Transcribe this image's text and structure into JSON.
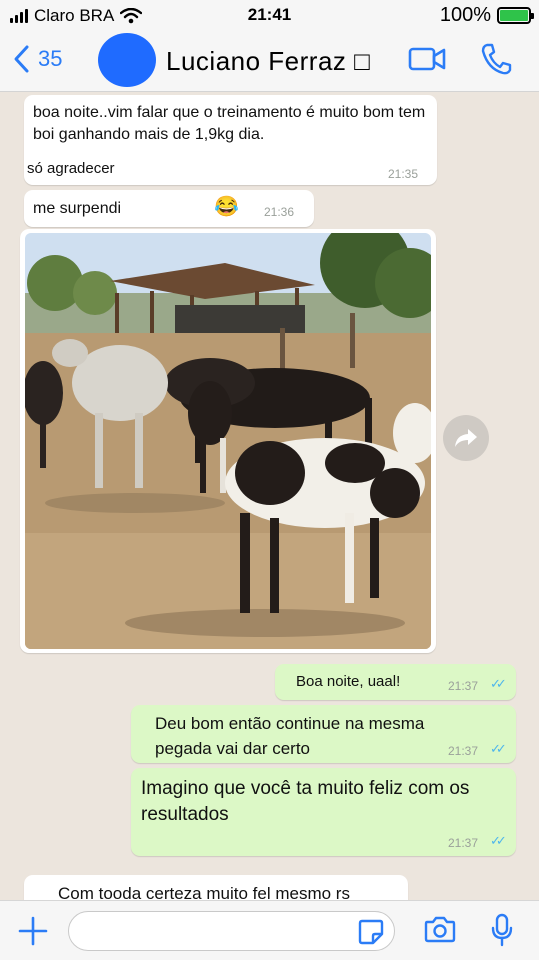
{
  "status_bar": {
    "carrier": "Claro BRA",
    "time": "21:41",
    "battery": "100%"
  },
  "header": {
    "back_count": "35",
    "contact_name": "Luciano Ferraz □"
  },
  "messages": [
    {
      "direction": "in",
      "text": "boa noite..vim falar que o treinamento é muito bom tem boi ganhando mais de 1,9kg dia.",
      "time": ""
    },
    {
      "direction": "in",
      "text": "só agradecer",
      "time": "21:35"
    },
    {
      "direction": "in",
      "text": "me surpendi",
      "emoji": "😂",
      "time": "21:36"
    },
    {
      "direction": "in",
      "type": "image",
      "description_icon": "cattle-photo"
    },
    {
      "direction": "out",
      "text": "Boa noite, uaal!",
      "time": "21:37"
    },
    {
      "direction": "out",
      "text": "Deu bom então continue na mesma pegada vai dar certo",
      "time": "21:37"
    },
    {
      "direction": "out",
      "text": "Imagino que você ta muito feliz com os resultados",
      "time": "21:37"
    },
    {
      "direction": "in",
      "text": "Com tooda certeza muito fel mesmo rs",
      "time": ""
    }
  ],
  "composer": {
    "placeholder": ""
  },
  "colors": {
    "accent": "#2b7cf6",
    "outgoing_bubble": "#dcf8c6",
    "incoming_bubble": "#ffffff",
    "read_ticks": "#4fb6ec",
    "chat_bg": "#ece5dd"
  },
  "icons": [
    "back-chevron-icon",
    "video-call-icon",
    "phone-call-icon",
    "forward-icon",
    "plus-icon",
    "sticker-icon",
    "camera-icon",
    "microphone-icon",
    "wifi-icon",
    "signal-icon",
    "battery-icon"
  ]
}
